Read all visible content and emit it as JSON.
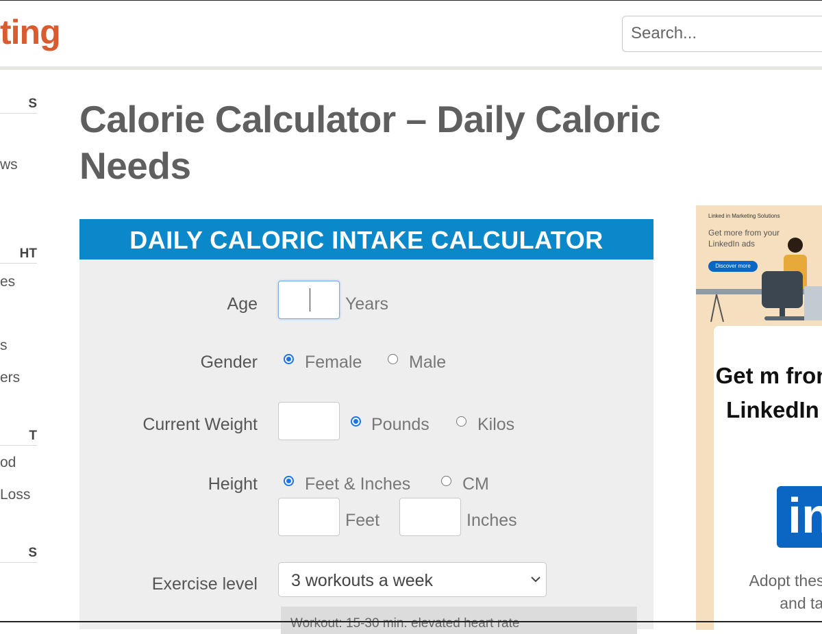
{
  "header": {
    "logo_text": "ting",
    "search_placeholder": "Search..."
  },
  "sidebar": {
    "items": [
      {
        "type": "heading",
        "text": "S"
      },
      {
        "type": "link",
        "text": "ws"
      },
      {
        "type": "heading",
        "text": "HT"
      },
      {
        "type": "link",
        "text": "es"
      },
      {
        "type": "link",
        "text": "s"
      },
      {
        "type": "link",
        "text": "ers"
      },
      {
        "type": "heading",
        "text": "T"
      },
      {
        "type": "link",
        "text": "od"
      },
      {
        "type": "link",
        "text": "Loss"
      },
      {
        "type": "heading",
        "text": "S"
      }
    ]
  },
  "page": {
    "title": "Calorie Calculator – Daily Caloric Needs"
  },
  "calculator": {
    "header": "DAILY CALORIC INTAKE CALCULATOR",
    "age": {
      "label": "Age",
      "value": "",
      "unit": "Years"
    },
    "gender": {
      "label": "Gender",
      "options": [
        "Female",
        "Male"
      ],
      "selected": "Female"
    },
    "weight": {
      "label": "Current Weight",
      "value": "",
      "options": [
        "Pounds",
        "Kilos"
      ],
      "selected": "Pounds"
    },
    "height": {
      "label": "Height",
      "options": [
        "Feet & Inches",
        "CM"
      ],
      "selected": "Feet & Inches",
      "feet_unit": "Feet",
      "inches_unit": "Inches"
    },
    "exercise": {
      "label": "Exercise level",
      "selected": "3 workouts a week",
      "description": "Workout: 15-30 min. elevated heart rate"
    }
  },
  "ad": {
    "brand": "Linked in Marketing Solutions",
    "tagline": "Get more from your LinkedIn ads",
    "cta": "Discover more",
    "heading": "Get m fron LinkedIn",
    "logo": "in",
    "copy": "Adopt these tips and tac"
  },
  "colors": {
    "brand_orange": "#d95b30",
    "calc_header_blue": "#0b88c9",
    "linkedin_blue": "#0a66c2"
  }
}
